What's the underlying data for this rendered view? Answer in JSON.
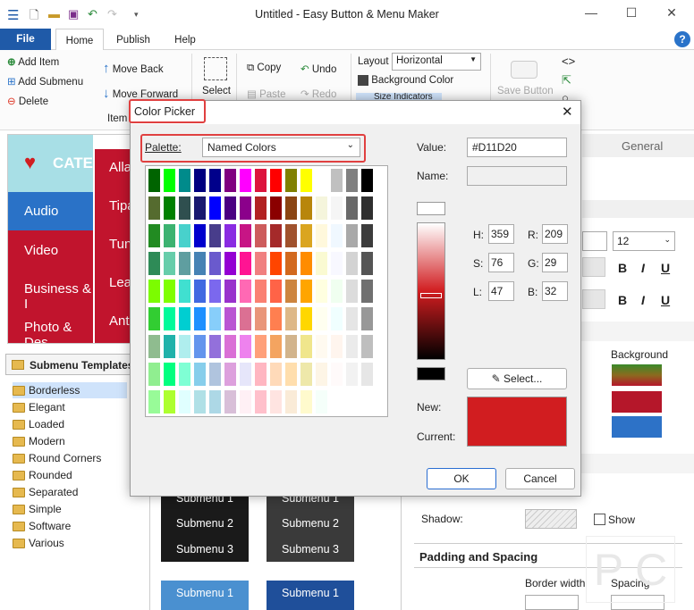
{
  "window": {
    "title": "Untitled - Easy Button & Menu Maker",
    "minimize": "—",
    "maximize": "☐",
    "close": "✕"
  },
  "quick_access": {
    "customize": "▾"
  },
  "ribbon_tabs": {
    "file": "File",
    "home": "Home",
    "publish": "Publish",
    "help": "Help",
    "help_icon": "?"
  },
  "ribbon": {
    "add_item": "Add Item",
    "add_submenu": "Add Submenu",
    "delete": "Delete",
    "move_back": "Move Back",
    "move_forward": "Move Forward",
    "items_group": "Item",
    "select": "Select",
    "copy": "Copy",
    "paste": "Paste",
    "undo": "Undo",
    "redo": "Redo",
    "layout_label": "Layout",
    "layout_value": "Horizontal",
    "background_color": "Background Color",
    "size_indicators": "Size Indicators",
    "save_button": "Save Button"
  },
  "preview": {
    "cat_label": "CATE",
    "menu_items": [
      "Audio",
      "Video",
      "Business & I",
      "Photo & Des"
    ],
    "submenu_items": [
      "Alla",
      "Tipa",
      "Tun",
      "Lea",
      "Ant"
    ]
  },
  "templates": {
    "header": "Submenu Templates",
    "items": [
      "Borderless",
      "Elegant",
      "Loaded",
      "Modern",
      "Round Corners",
      "Rounded",
      "Separated",
      "Simple",
      "Software",
      "Various"
    ],
    "selected": "Borderless"
  },
  "tiles": {
    "dark_a": [
      "Submenu 1",
      "Submenu 2",
      "Submenu 3"
    ],
    "dark_b": [
      "Submenu 1",
      "Submenu 2",
      "Submenu 3"
    ],
    "blue_a": "Submenu 1",
    "blue_b": "Submenu 1"
  },
  "right_panel": {
    "general_tab": "General",
    "font_size": "12",
    "background_label": "Background",
    "shadow_label": "Shadow:",
    "show_label": "Show",
    "padding_header": "Padding and Spacing",
    "border_width": "Border width",
    "spacing": "Spacing",
    "bold": "B",
    "italic": "I",
    "underline": "U",
    "swatch_colors": [
      "#8b6a1f",
      "#b5172a",
      "#2d72c7"
    ]
  },
  "dialog": {
    "title": "Color Picker",
    "palette_label": "Palette:",
    "palette_value": "Named Colors",
    "value_label": "Value:",
    "value": "#D11D20",
    "name_label": "Name:",
    "name_value": "",
    "h_label": "H:",
    "h": "359",
    "s_label": "S:",
    "s": "76",
    "l_label": "L:",
    "l": "47",
    "r_label": "R:",
    "r": "209",
    "g_label": "G:",
    "g": "29",
    "b_label": "B:",
    "b": "32",
    "select_button": "Select...",
    "new_label": "New:",
    "current_label": "Current:",
    "ok": "OK",
    "cancel": "Cancel",
    "selected_color": "#D11D20",
    "palette_columns": [
      [
        "#006400",
        "#556B2F",
        "#228B22",
        "#2E8B57",
        "#7CFC00",
        "#32CD32",
        "#8FBC8F",
        "#90EE90",
        "#98FB98"
      ],
      [
        "#00FF00",
        "#008000",
        "#3CB371",
        "#66CDAA",
        "#7FFF00",
        "#00FA9A",
        "#20B2AA",
        "#00FF7F",
        "#ADFF2F"
      ],
      [
        "#008B8B",
        "#2F4F4F",
        "#48D1CC",
        "#5F9EA0",
        "#40E0D0",
        "#00CED1",
        "#AFEEEE",
        "#7FFFD4",
        "#E0FFFF"
      ],
      [
        "#000080",
        "#191970",
        "#0000CD",
        "#4682B4",
        "#4169E1",
        "#1E90FF",
        "#6495ED",
        "#87CEEB",
        "#B0E0E6"
      ],
      [
        "#00008B",
        "#0000FF",
        "#483D8B",
        "#6A5ACD",
        "#7B68EE",
        "#87CEFA",
        "#9370DB",
        "#B0C4DE",
        "#ADD8E6"
      ],
      [
        "#800080",
        "#4B0082",
        "#8A2BE2",
        "#9400D3",
        "#9932CC",
        "#BA55D3",
        "#DA70D6",
        "#DDA0DD",
        "#D8BFD8"
      ],
      [
        "#FF00FF",
        "#8B008B",
        "#C71585",
        "#FF1493",
        "#FF69B4",
        "#DB7093",
        "#EE82EE",
        "#E6E6FA",
        "#FFF0F5"
      ],
      [
        "#DC143C",
        "#B22222",
        "#CD5C5C",
        "#F08080",
        "#FA8072",
        "#E9967A",
        "#FFA07A",
        "#FFB6C1",
        "#FFC0CB"
      ],
      [
        "#FF0000",
        "#8B0000",
        "#A52A2A",
        "#FF4500",
        "#FF6347",
        "#FF7F50",
        "#F4A460",
        "#FFDAB9",
        "#FFE4E1"
      ],
      [
        "#808000",
        "#8B4513",
        "#A0522D",
        "#D2691E",
        "#CD853F",
        "#DEB887",
        "#D2B48C",
        "#FFDEAD",
        "#FAEBD7"
      ],
      [
        "#FFFF00",
        "#B8860B",
        "#DAA520",
        "#FF8C00",
        "#FFA500",
        "#FFD700",
        "#F0E68C",
        "#EEE8AA",
        "#FFFACD"
      ],
      [
        "#FFFFFF",
        "#F5F5DC",
        "#FFF8DC",
        "#FAFAD2",
        "#FFFFE0",
        "#FFFFF0",
        "#FFFAF0",
        "#FDF5E6",
        "#F5FFFA"
      ],
      [
        "#C0C0C0",
        "#F5F5F5",
        "#F0F8FF",
        "#F8F8FF",
        "#F0FFF0",
        "#F0FFFF",
        "#FFF5EE",
        "#FFFAFA",
        "#FFFFFF"
      ],
      [
        "#808080",
        "#696969",
        "#A9A9A9",
        "#D3D3D3",
        "#DCDCDC",
        "#E5E5E5",
        "#EBEBEB",
        "#F2F2F2",
        "#FFFFFF"
      ],
      [
        "#000000",
        "#2F2F2F",
        "#3C3C3C",
        "#555555",
        "#707070",
        "#989898",
        "#BEBEBE",
        "#E6E6E6",
        "#FFFFFF"
      ]
    ]
  },
  "watermark": "P C"
}
